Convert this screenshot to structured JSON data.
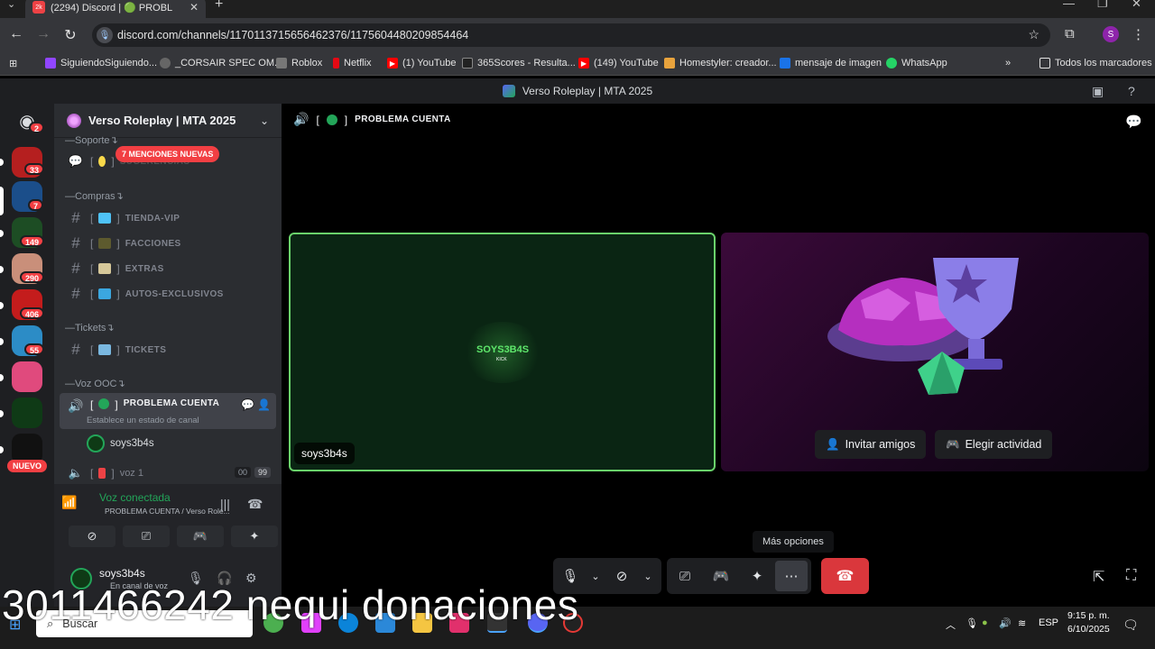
{
  "browser": {
    "tab_title": "(2294) Discord | 🟢 PROBL",
    "url": "discord.com/channels/1170113715656462376/1175604480209854464",
    "profile_initial": "S",
    "bookmarks": [
      {
        "label": "SiguiendoSiguiendo...",
        "color": "#9146ff"
      },
      {
        "label": "_CORSAIR SPEC OM...",
        "color": "#666"
      },
      {
        "label": "Roblox",
        "color": "#777"
      },
      {
        "label": "Netflix",
        "color": "#e50914"
      },
      {
        "label": "(1) YouTube",
        "color": "#ff0000"
      },
      {
        "label": "365Scores - Resulta...",
        "color": "#222"
      },
      {
        "label": "(149) YouTube",
        "color": "#ff0000"
      },
      {
        "label": "Homestyler: creador...",
        "color": "#e8a33d"
      },
      {
        "label": "mensaje de imagen",
        "color": "#1a73e8"
      },
      {
        "label": "WhatsApp",
        "color": "#25d366"
      }
    ],
    "all_bookmarks": "Todos los marcadores"
  },
  "discord": {
    "window_title": "Verso Roleplay | MTA 2025",
    "home_badge": "2",
    "guilds": [
      {
        "badge": "33",
        "color": "#b51f1f"
      },
      {
        "badge": "7",
        "color": "#1b4e8a"
      },
      {
        "badge": "149",
        "color": "#1d4d24"
      },
      {
        "badge": "290",
        "color": "#c98f7a"
      },
      {
        "badge": "406",
        "color": "#c41c1c"
      },
      {
        "badge": "55",
        "color": "#2c8cc6"
      },
      {
        "badge": "",
        "color": "#e04a7d"
      },
      {
        "badge": "",
        "color": "#0f3a16"
      },
      {
        "badge": "",
        "color": "#111"
      }
    ],
    "nuevo": "NUEVO",
    "server_name": "Verso Roleplay | MTA 2025",
    "mentions_badge": "7 MENCIONES NUEVAS",
    "categories": {
      "soporte": "—Soporte↴",
      "compras": "—Compras↴",
      "tickets": "—Tickets↴",
      "voz_ooc": "—Voz OOC↴"
    },
    "channels": {
      "soporte_ch": "SUGERENCIAS",
      "tienda": "TIENDA-VIP",
      "facciones": "FACCIONES",
      "extras": "EXTRAS",
      "autos": "AUTOS-EXCLUSIVOS",
      "tickets": "TICKETS",
      "problema": "PROBLEMA CUENTA",
      "status_placeholder": "Establece un estado de canal",
      "member": "soys3b4s",
      "voz1": "voz 1",
      "voz1_count_a": "00",
      "voz1_count_b": "99"
    },
    "voice_panel": {
      "status": "Voz conectada",
      "location": "PROBLEMA CUENTA / Verso Role..."
    },
    "user": {
      "name": "soys3b4s",
      "status": "En canal de voz"
    },
    "stage": {
      "channel_title": "PROBLEMA CUENTA",
      "tile_user": "soys3b4s",
      "tile_logo": "SOYS3B4S",
      "tile_logo_sub": "KICK",
      "invite": "Invitar amigos",
      "activity": "Elegir actividad",
      "tooltip": "Más opciones"
    }
  },
  "overlay": {
    "text": "3011466242 nequi donaciones"
  },
  "taskbar": {
    "search_placeholder": "Buscar",
    "lang": "ESP",
    "time": "9:15 p. m.",
    "date": "6/10/2025"
  }
}
